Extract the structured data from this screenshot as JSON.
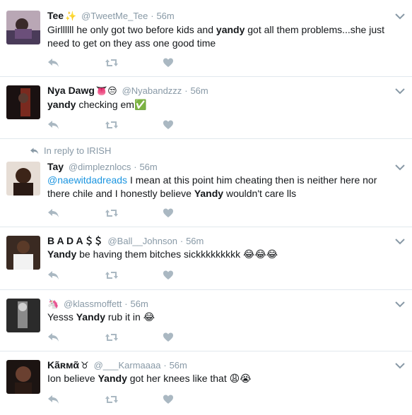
{
  "tweets": [
    {
      "name": "Tee",
      "emoji": "✨",
      "handle": "@TweetMe_Tee",
      "sep": "·",
      "time": "56m",
      "text_pre": "Girllllll he only got two before kids and ",
      "text_bold": "yandy",
      "text_post": " got all them problems...she just need to get on they ass one good time"
    },
    {
      "name": "Nya Dawg",
      "emoji": "👅😒",
      "handle": "@Nyabandzzz",
      "sep": "·",
      "time": "56m",
      "text_bold": "yandy",
      "text_post": " checking em",
      "text_emoji": "✅"
    },
    {
      "reply_context": "In reply to IRISH",
      "name": "Tay",
      "handle": "@dimpleznlocs",
      "sep": "·",
      "time": "56m",
      "mention": "@naewitdadreads",
      "text_pre": " I mean at this point him cheating then is neither here nor there chile and I honestly believe ",
      "text_bold": "Yandy",
      "text_post": " wouldn't care lls"
    },
    {
      "name": "B A D A",
      "emoji": "＄＄",
      "handle": "@Ball__Johnson",
      "sep": "·",
      "time": "56m",
      "text_bold": "Yandy",
      "text_post": " be having them bitches sickkkkkkkkk ",
      "text_emoji": "😂😂😂"
    },
    {
      "emoji": "🦄",
      "handle": "@klassmoffett",
      "sep": "·",
      "time": "56m",
      "text_pre": "Yesss ",
      "text_bold": "Yandy",
      "text_post": " rub it in ",
      "text_emoji": "😂"
    },
    {
      "name": "Kãʀᴍᾶ",
      "emoji": "♉",
      "handle": "@___Karmaaaa",
      "sep": "·",
      "time": "56m",
      "text_pre": "Ion believe ",
      "text_bold": "Yandy",
      "text_post": " got her knees like that ",
      "text_emoji": "😩😭"
    }
  ],
  "icons": {
    "reply": "reply-icon",
    "retweet": "retweet-icon",
    "like": "heart-icon",
    "caret": "chevron-down-icon"
  },
  "colors": {
    "name": "#14171a",
    "muted": "#8899a6",
    "mention": "#1b95e0",
    "action_icon": "#aab8c2",
    "divider": "#e1e8ed"
  }
}
